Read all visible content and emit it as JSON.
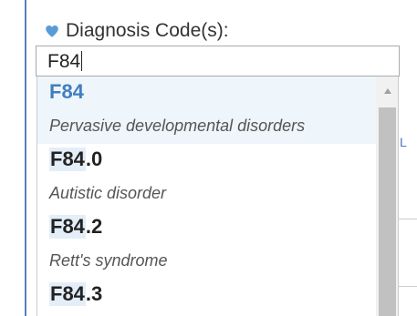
{
  "field": {
    "label": "Diagnosis Code(s):",
    "input_value": "F84"
  },
  "dropdown": {
    "options": [
      {
        "match": "F84",
        "rest": "",
        "description": "Pervasive developmental disorders",
        "highlighted": true
      },
      {
        "match": "F84",
        "rest": ".0",
        "description": "Autistic disorder",
        "highlighted": false
      },
      {
        "match": "F84",
        "rest": ".2",
        "description": "Rett's syndrome",
        "highlighted": false
      },
      {
        "match": "F84",
        "rest": ".3",
        "description": "",
        "highlighted": false
      }
    ]
  },
  "icons": {
    "label_icon": "heart-icon",
    "scroll_icon": "triangle-up-icon"
  },
  "colors": {
    "accent": "#5b9bd5",
    "highlight_bg": "#eef5fb",
    "match_text": "#3f7fbf"
  },
  "background": {
    "partial_link_text": "L"
  }
}
